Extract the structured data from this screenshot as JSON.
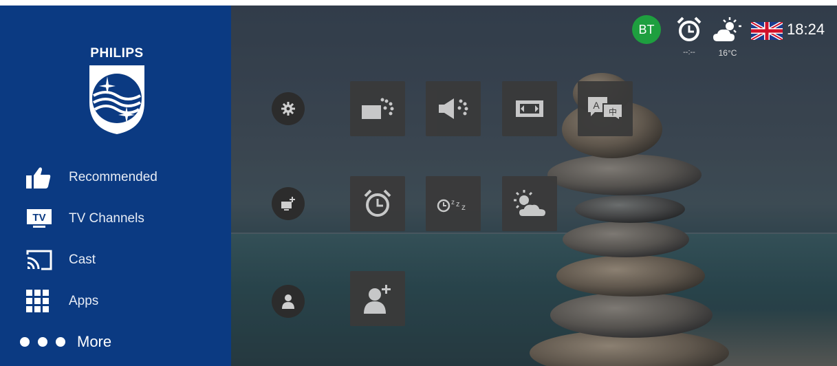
{
  "sidebar": {
    "logo_text": "PHILIPS",
    "items": [
      {
        "label": "Recommended",
        "icon": "thumbs-up-icon"
      },
      {
        "label": "TV Channels",
        "icon": "tv-icon"
      },
      {
        "label": "Cast",
        "icon": "cast-icon"
      },
      {
        "label": "Apps",
        "icon": "apps-grid-icon"
      },
      {
        "label": "More",
        "icon": "more-dots-icon"
      }
    ]
  },
  "status": {
    "badge": "BT",
    "alarm_time": "--:--",
    "temperature": "16°C",
    "clock": "18:24"
  },
  "quick_settings": {
    "row1": [
      "settings-gear-icon",
      "picture-style-icon",
      "sound-style-icon",
      "picture-format-icon",
      "subtitle-language-icon"
    ],
    "row2": [
      "add-device-icon",
      "alarm-clock-icon",
      "sleep-timer-icon",
      "weather-icon"
    ],
    "row3": [
      "user-icon",
      "add-user-icon"
    ]
  },
  "colors": {
    "sidebar": "#0b3a82",
    "badge": "#1e9f3f",
    "tile": "#3a3a3a"
  }
}
